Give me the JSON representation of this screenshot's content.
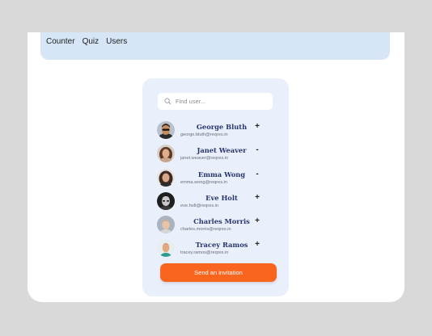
{
  "nav": {
    "links": [
      "Counter",
      "Quiz",
      "Users"
    ]
  },
  "search": {
    "placeholder": "Find user..."
  },
  "users": [
    {
      "name": "George Bluth",
      "email": "george.bluth@reqres.in",
      "action": "+"
    },
    {
      "name": "Janet Weaver",
      "email": "janet.weaver@reqres.in",
      "action": "-"
    },
    {
      "name": "Emma Wong",
      "email": "emma.wong@reqres.in",
      "action": "-"
    },
    {
      "name": "Eve Holt",
      "email": "eve.holt@reqres.in",
      "action": "+"
    },
    {
      "name": "Charles Morris",
      "email": "charles.morris@reqres.in",
      "action": "+"
    },
    {
      "name": "Tracey Ramos",
      "email": "tracey.ramos@reqres.in",
      "action": "+"
    }
  ],
  "invite_button": {
    "label": "Send an invitation"
  },
  "colors": {
    "navbar": "#d6e6f7",
    "card": "#eaf0fb",
    "accent": "#f9651f",
    "name_text": "#27356b"
  }
}
